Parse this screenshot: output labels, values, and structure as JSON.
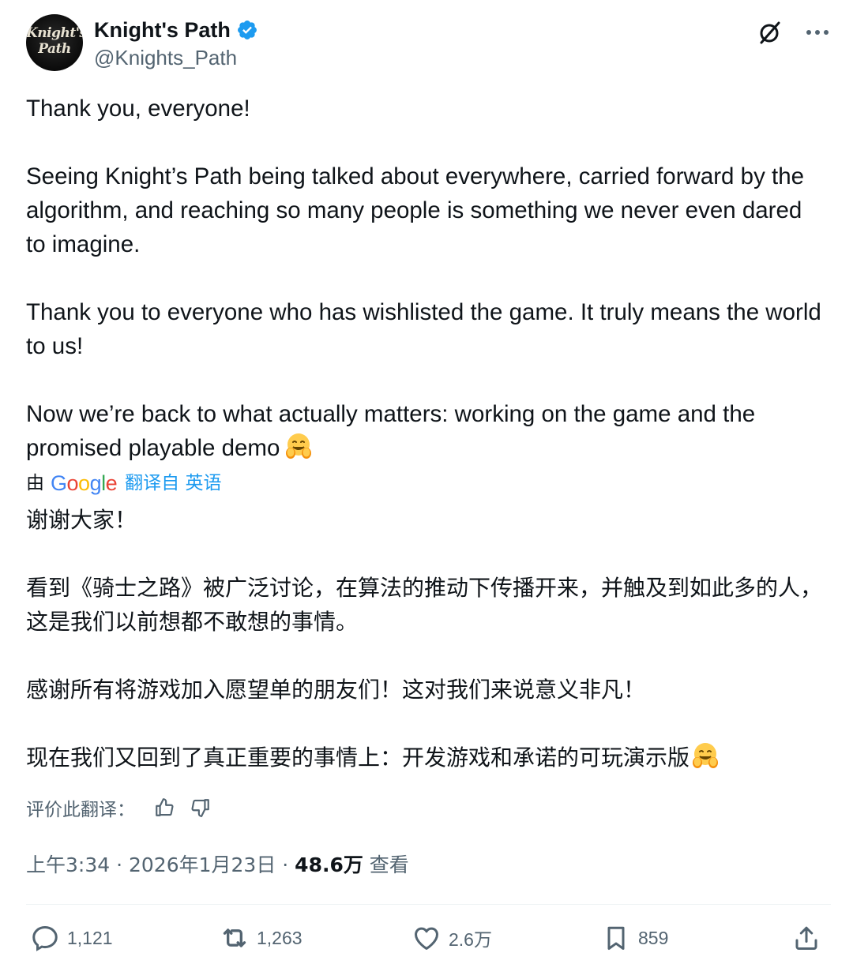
{
  "author": {
    "display_name": "Knight's Path",
    "handle": "@Knights_Path",
    "avatar_text_line1": "Knight's",
    "avatar_text_line2": "Path",
    "verified_color": "#1d9bf0"
  },
  "tweet": {
    "p1": "Thank you, everyone!",
    "p2": "Seeing Knight’s Path being talked about everywhere, carried forward by the algorithm, and reaching so many people is something we never even dared to imagine.",
    "p3": "Thank you to everyone who has wishlisted the game. It truly means the world to us!",
    "p4": "Now we’re back to what actually matters: working on the game and the promised playable demo",
    "p4_emoji": "hugging-face-emoji"
  },
  "translation": {
    "by_label": "由",
    "provider_letters": [
      "G",
      "o",
      "o",
      "g",
      "l",
      "e"
    ],
    "link_label": "翻译自 英语",
    "z1": "谢谢大家！",
    "z2": "看到《骑士之路》被广泛讨论，在算法的推动下传播开来，并触及到如此多的人，这是我们以前想都不敢想的事情。",
    "z3": "感谢所有将游戏加入愿望单的朋友们！这对我们来说意义非凡！",
    "z4": "现在我们又回到了真正重要的事情上：开发游戏和承诺的可玩演示版",
    "rate_label": "评价此翻译："
  },
  "meta": {
    "time": "上午3:34",
    "sep1": " · ",
    "date": "2026年1月23日",
    "sep2": " · ",
    "views_count": "48.6万",
    "views_label": " 查看"
  },
  "actions": {
    "replies": "1,121",
    "reposts": "1,263",
    "likes": "2.6万",
    "bookmarks": "859"
  },
  "colors": {
    "text": "#0f1419",
    "secondary": "#536471",
    "link": "#1d9bf0",
    "divider": "#eff3f4"
  }
}
